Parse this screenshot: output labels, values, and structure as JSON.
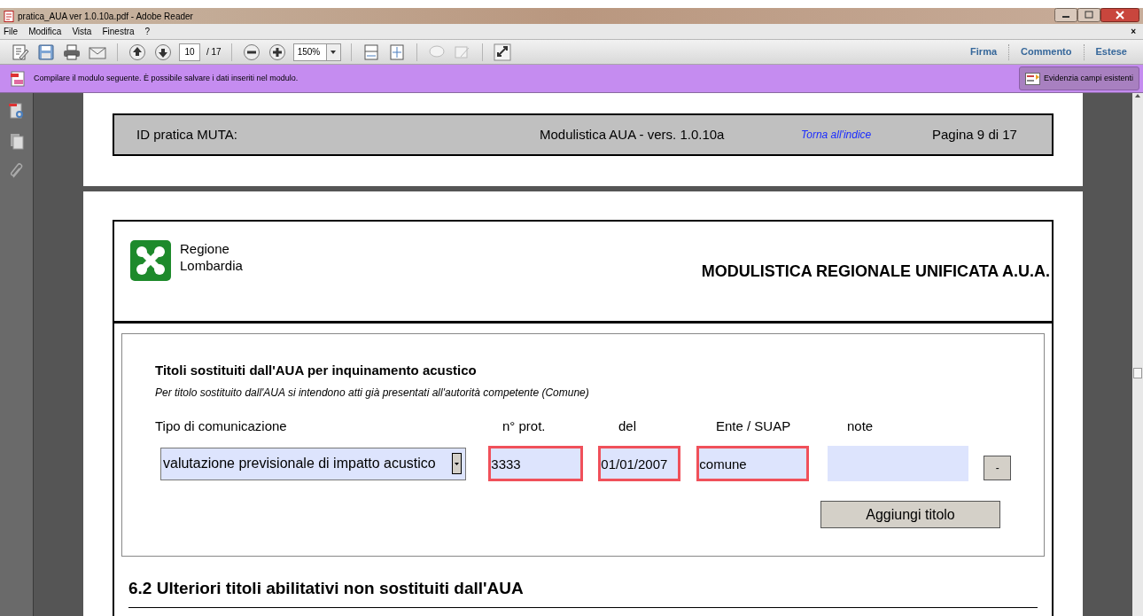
{
  "window": {
    "title": "pratica_AUA ver 1.0.10a.pdf - Adobe Reader"
  },
  "menu": [
    "File",
    "Modifica",
    "Vista",
    "Finestra",
    "?"
  ],
  "menu_close": "×",
  "toolbar": {
    "page": "10",
    "page_total": "/ 17",
    "zoom": "150%",
    "links": [
      "Firma",
      "Commento",
      "Estese"
    ]
  },
  "form_bar": {
    "message": "Compilare il modulo seguente. È possibile salvare i dati inseriti nel modulo.",
    "button": "Evidenzia campi esistenti"
  },
  "page_header": {
    "id_label": "ID pratica MUTA:",
    "version": "Modulistica AUA - vers. 1.0.10a",
    "index_link": "Torna all'indice",
    "page": "Pagina 9 di 17"
  },
  "logo": {
    "lines": [
      "Regione",
      "Lombardia"
    ]
  },
  "form_title": "MODULISTICA REGIONALE UNIFICATA A.U.A.",
  "section": {
    "title": "Titoli sostituiti dall'AUA per inquinamento acustico",
    "subtitle": "Per titolo sostituito dall'AUA si intendono atti già presentati all'autorità competente (Comune)",
    "columns": [
      "Tipo di comunicazione",
      "n° prot.",
      "del",
      "Ente / SUAP",
      "note"
    ],
    "row": {
      "type": "valutazione previsionale di impatto acustico",
      "fields": [
        {
          "value": "3333",
          "required": true
        },
        {
          "value": "01/01/2007",
          "required": true
        },
        {
          "value": "comune",
          "required": true
        },
        {
          "required": false
        }
      ],
      "remove": "-"
    },
    "add_button": "Aggiungi titolo"
  },
  "next_section": "6.2 Ulteriori titoli abilitativi non sostituiti dall'AUA"
}
